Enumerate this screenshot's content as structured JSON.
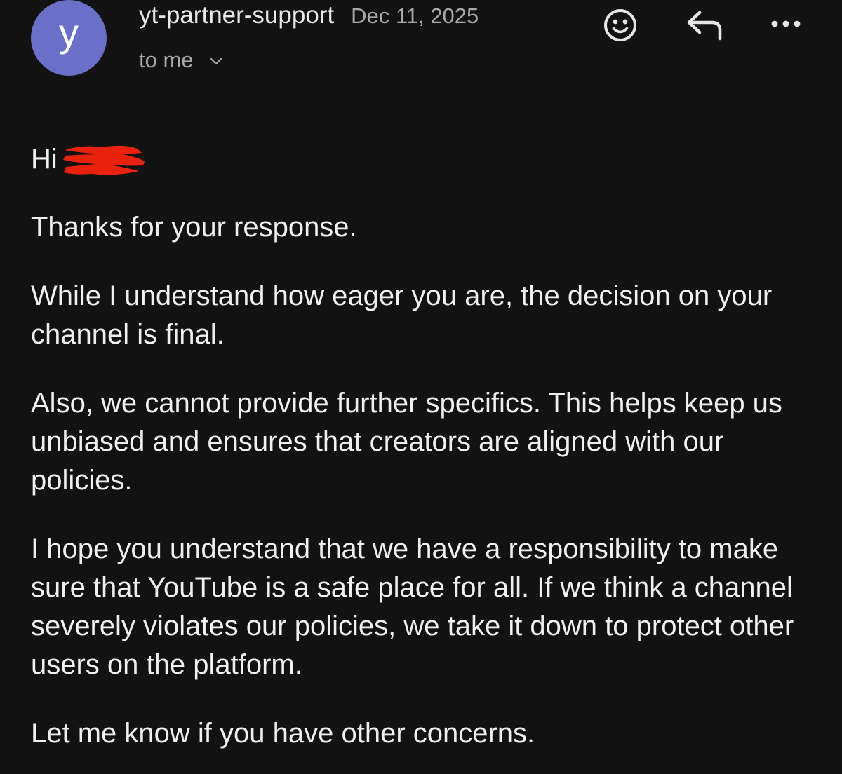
{
  "email": {
    "sender": {
      "avatar_letter": "y",
      "avatar_color": "#6a70c8",
      "name": "yt-partner-support"
    },
    "date": "Dec 11, 2025",
    "recipient_label": "to me",
    "actions": {
      "emoji_icon": "smiley-face-icon",
      "reply_icon": "reply-arrow-icon",
      "more_icon": "more-options-icon"
    },
    "body": {
      "greeting": "Hi",
      "redaction_color": "#e8220f",
      "paragraphs": [
        "Thanks for your response.",
        "While I understand how eager you are, the decision on your channel is final.",
        "Also, we cannot provide further specifics. This helps keep us unbiased and ensures that creators are aligned with our policies.",
        "I hope you understand that we have a responsibility to make sure that YouTube is a safe place for all. If we think a channel severely violates our policies, we take it down to protect other users on the platform.",
        "Let me know if you have other concerns."
      ]
    }
  },
  "theme": {
    "background": "#121212",
    "text": "#f0f0f0",
    "muted_text": "#a8a8a8"
  }
}
